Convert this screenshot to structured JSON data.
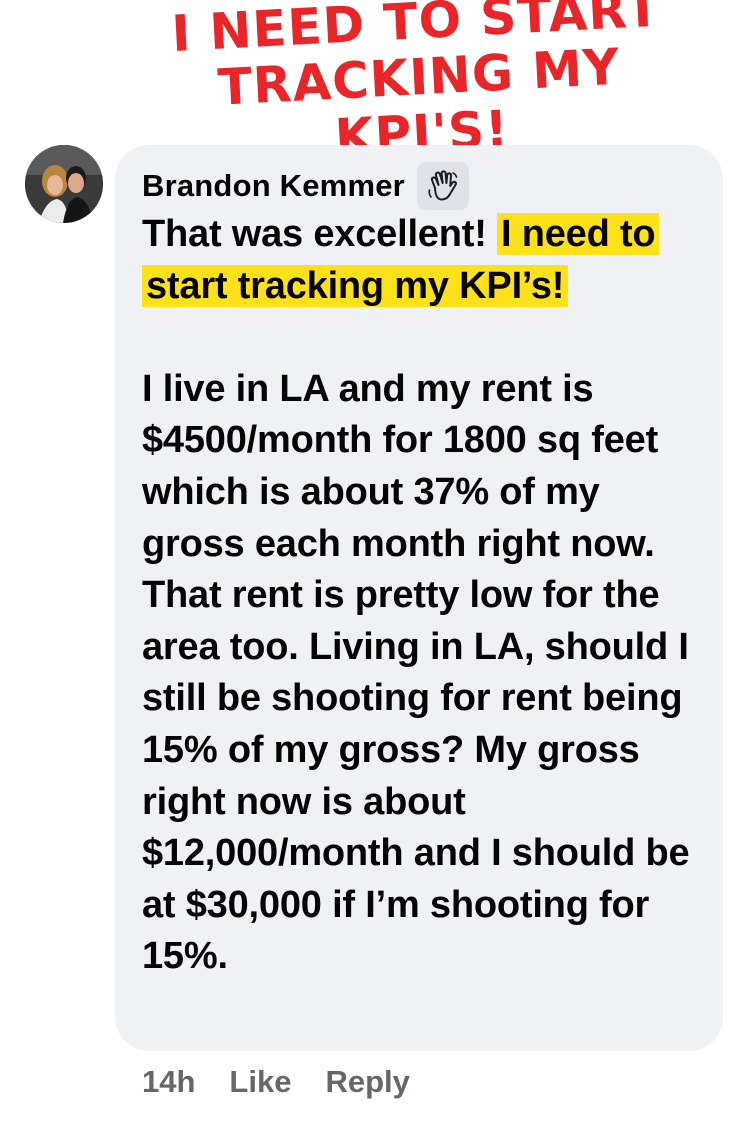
{
  "headline": {
    "line1": "I NEED TO START",
    "line2": "TRACKING MY KPI'S!",
    "color": "#e8262a"
  },
  "comment": {
    "author": "Brandon Kemmer",
    "badge_icon": "waving-hand-icon",
    "intro": "That was excellent! ",
    "highlight": "I need to start tracking my KPI’s!",
    "highlight_color": "#ffe11a",
    "body": "I live in LA and my rent is $4500/month for 1800 sq feet which is about 37% of my gross each month right now. That rent is pretty low for the area too. Living in LA, should I still be shooting for rent being 15% of my gross? My gross right now is about $12,000/month and I should be at $30,000 if I’m shooting for 15%.",
    "bubble_color": "#f0f1f5"
  },
  "actions": {
    "time": "14h",
    "like_label": "Like",
    "reply_label": "Reply"
  }
}
